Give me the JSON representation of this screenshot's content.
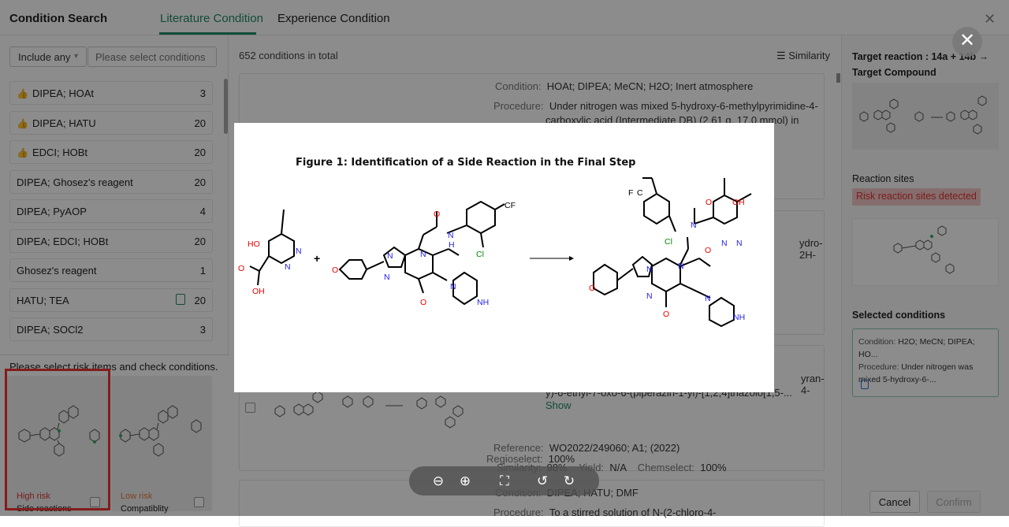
{
  "header": {
    "app_title": "Condition Search",
    "tabs": [
      {
        "label": "Literature Condition",
        "active": true
      },
      {
        "label": "Experience Condition",
        "active": false
      }
    ]
  },
  "left": {
    "include_label": "Include any",
    "conditions_placeholder": "Please select conditions",
    "conditions": [
      {
        "name": "DIPEA; HOAt",
        "count": "3",
        "recommended": true
      },
      {
        "name": "DIPEA; HATU",
        "count": "20",
        "recommended": true
      },
      {
        "name": "EDCI; HOBt",
        "count": "20",
        "recommended": true
      },
      {
        "name": "DIPEA; Ghosez's reagent",
        "count": "20"
      },
      {
        "name": "DIPEA; PyAOP",
        "count": "4"
      },
      {
        "name": "DIPEA; EDCI; HOBt",
        "count": "20"
      },
      {
        "name": "Ghosez's reagent",
        "count": "1"
      },
      {
        "name": "HATU; TEA",
        "count": "20",
        "has_doc": true
      },
      {
        "name": "DIPEA; SOCl2",
        "count": "3"
      }
    ],
    "risk_title": "Please select risk items and check conditions.",
    "risk_cards": [
      {
        "level": "High risk",
        "type": "Side reactions",
        "color": "#d33"
      },
      {
        "level": "Low risk",
        "type": "Compatiblity",
        "color": "#e07b39"
      }
    ]
  },
  "middle": {
    "total_text": "652 conditions in total",
    "sort_label": "Similarity",
    "card1": {
      "condition_key": "Condition:",
      "condition": "HOAt; DIPEA; MeCN; H2O; Inert atmosphere",
      "procedure_key": "Procedure:",
      "procedure_line1": "Under nitrogen was mixed 5-hydroxy-6-methylpyrimidine-4-",
      "procedure_line2": "carboxylic acid (Intermediate DB) (2.61 g, 17.0 mmol) in ACN..."
    },
    "card2": {
      "fragment": "ydro-2H-"
    },
    "card3": {
      "fragment1": "yran-4-",
      "fragment2": "y)-6-ethyl-7-oxo-6-(piperazin-1-yl)-[1,2,4]triazolo[1,5-...",
      "show": "Show",
      "reference_key": "Reference:",
      "reference": "WO2022/249060; A1; (2022)",
      "similarity_key": "Similarity:",
      "similarity": "98%",
      "yield_key": "Yield:",
      "yield": "N/A",
      "chemselect_key": "Chemselect:",
      "chemselect": "100%",
      "regioselect_key": "Regioselect:",
      "regioselect": "100%"
    },
    "card4": {
      "condition_key": "Condition:",
      "condition": "DIPEA; HATU; DMF",
      "procedure_key": "Procedure:",
      "procedure": "To a stirred solution of N-(2-chloro-4-"
    }
  },
  "right": {
    "target_title": "Target reaction : 14a + 14b → Target Compound",
    "reaction_sites_title": "Reaction sites",
    "risk_badge": "Risk reaction sites detected",
    "selected_title": "Selected conditions",
    "selected_condition_key": "Condition:",
    "selected_condition": "H2O; MeCN; DIPEA; HO...",
    "selected_procedure_key": "Procedure:",
    "selected_procedure": "Under nitrogen was mixed 5-hydroxy-6-...",
    "cancel": "Cancel",
    "confirm": "Confirm"
  },
  "figure": {
    "title": "Figure 1: Identification of a Side Reaction in the Final Step",
    "plus": "+",
    "labels": {
      "ho": "HO",
      "o": "O",
      "oh": "OH",
      "n": "N",
      "nh": "NH",
      "h": "H",
      "cl": "Cl",
      "cf": "CF",
      "f": "F",
      "c": "C"
    }
  },
  "toolbar": {
    "icons": [
      "zoom-out-icon",
      "zoom-in-icon",
      "fullscreen-icon",
      "rotate-left-icon",
      "rotate-right-icon"
    ]
  },
  "colors": {
    "accent": "#1f8a68",
    "risk_red": "#d33",
    "low_risk": "#e07b39",
    "highlight": "#e33"
  }
}
